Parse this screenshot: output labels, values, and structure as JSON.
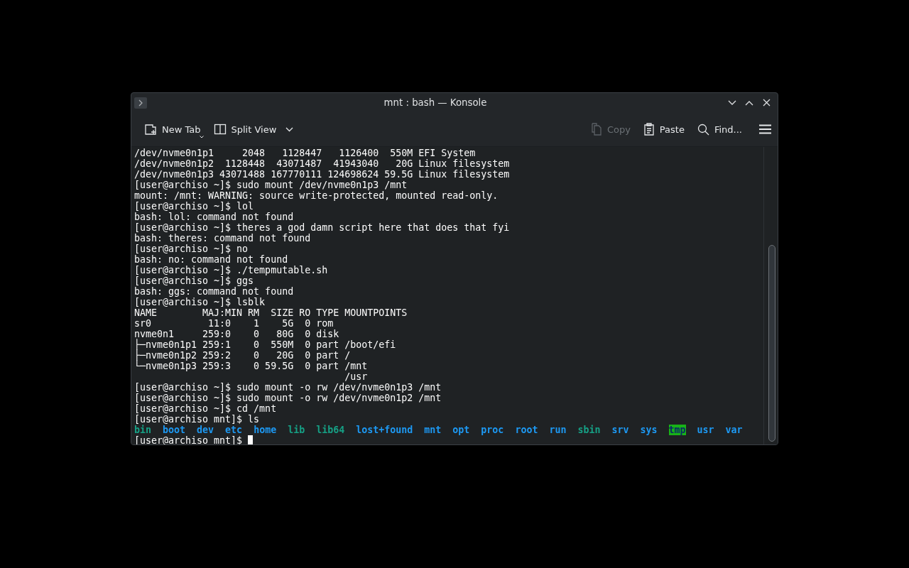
{
  "window": {
    "title": "mnt : bash — Konsole"
  },
  "toolbar": {
    "left": [
      {
        "label": "New Tab",
        "kind": "new-tab"
      },
      {
        "label": "Split View",
        "kind": "split"
      }
    ],
    "right": [
      {
        "label": "Copy",
        "kind": "copy",
        "disabled": true
      },
      {
        "label": "Paste",
        "kind": "paste",
        "disabled": false
      },
      {
        "label": "Find...",
        "kind": "find",
        "disabled": false
      }
    ]
  },
  "terminal": {
    "lines": [
      "/dev/nvme0n1p1     2048   1128447   1126400  550M EFI System",
      "/dev/nvme0n1p2  1128448  43071487  41943040   20G Linux filesystem",
      "/dev/nvme0n1p3 43071488 167770111 124698624 59.5G Linux filesystem",
      "[user@archiso ~]$ sudo mount /dev/nvme0n1p3 /mnt",
      "mount: /mnt: WARNING: source write-protected, mounted read-only.",
      "[user@archiso ~]$ lol",
      "bash: lol: command not found",
      "[user@archiso ~]$ theres a god damn script here that does that fyi",
      "bash: theres: command not found",
      "[user@archiso ~]$ no",
      "bash: no: command not found",
      "[user@archiso ~]$ ./tempmutable.sh",
      "[user@archiso ~]$ ggs",
      "bash: ggs: command not found",
      "[user@archiso ~]$ lsblk",
      "NAME        MAJ:MIN RM  SIZE RO TYPE MOUNTPOINTS",
      "sr0          11:0    1    5G  0 rom",
      "nvme0n1     259:0    0   80G  0 disk",
      "├─nvme0n1p1 259:1    0  550M  0 part /boot/efi",
      "├─nvme0n1p2 259:2    0   20G  0 part /",
      "└─nvme0n1p3 259:3    0 59.5G  0 part /mnt",
      "                                     /usr",
      "[user@archiso ~]$ sudo mount -o rw /dev/nvme0n1p3 /mnt",
      "[user@archiso ~]$ sudo mount -o rw /dev/nvme0n1p2 /mnt",
      "[user@archiso ~]$ cd /mnt",
      "[user@archiso mnt]$ ls"
    ],
    "listing": [
      {
        "name": "bin",
        "kind": "link"
      },
      {
        "name": "boot",
        "kind": "dir"
      },
      {
        "name": "dev",
        "kind": "dir"
      },
      {
        "name": "etc",
        "kind": "dir"
      },
      {
        "name": "home",
        "kind": "dir"
      },
      {
        "name": "lib",
        "kind": "link"
      },
      {
        "name": "lib64",
        "kind": "link"
      },
      {
        "name": "lost+found",
        "kind": "dir"
      },
      {
        "name": "mnt",
        "kind": "dir"
      },
      {
        "name": "opt",
        "kind": "dir"
      },
      {
        "name": "proc",
        "kind": "dir"
      },
      {
        "name": "root",
        "kind": "dir"
      },
      {
        "name": "run",
        "kind": "dir"
      },
      {
        "name": "sbin",
        "kind": "link"
      },
      {
        "name": "srv",
        "kind": "dir"
      },
      {
        "name": "sys",
        "kind": "dir"
      },
      {
        "name": "tmp",
        "kind": "sticky"
      },
      {
        "name": "usr",
        "kind": "dir"
      },
      {
        "name": "var",
        "kind": "dir"
      }
    ],
    "prompt": "[user@archiso mnt]$"
  }
}
